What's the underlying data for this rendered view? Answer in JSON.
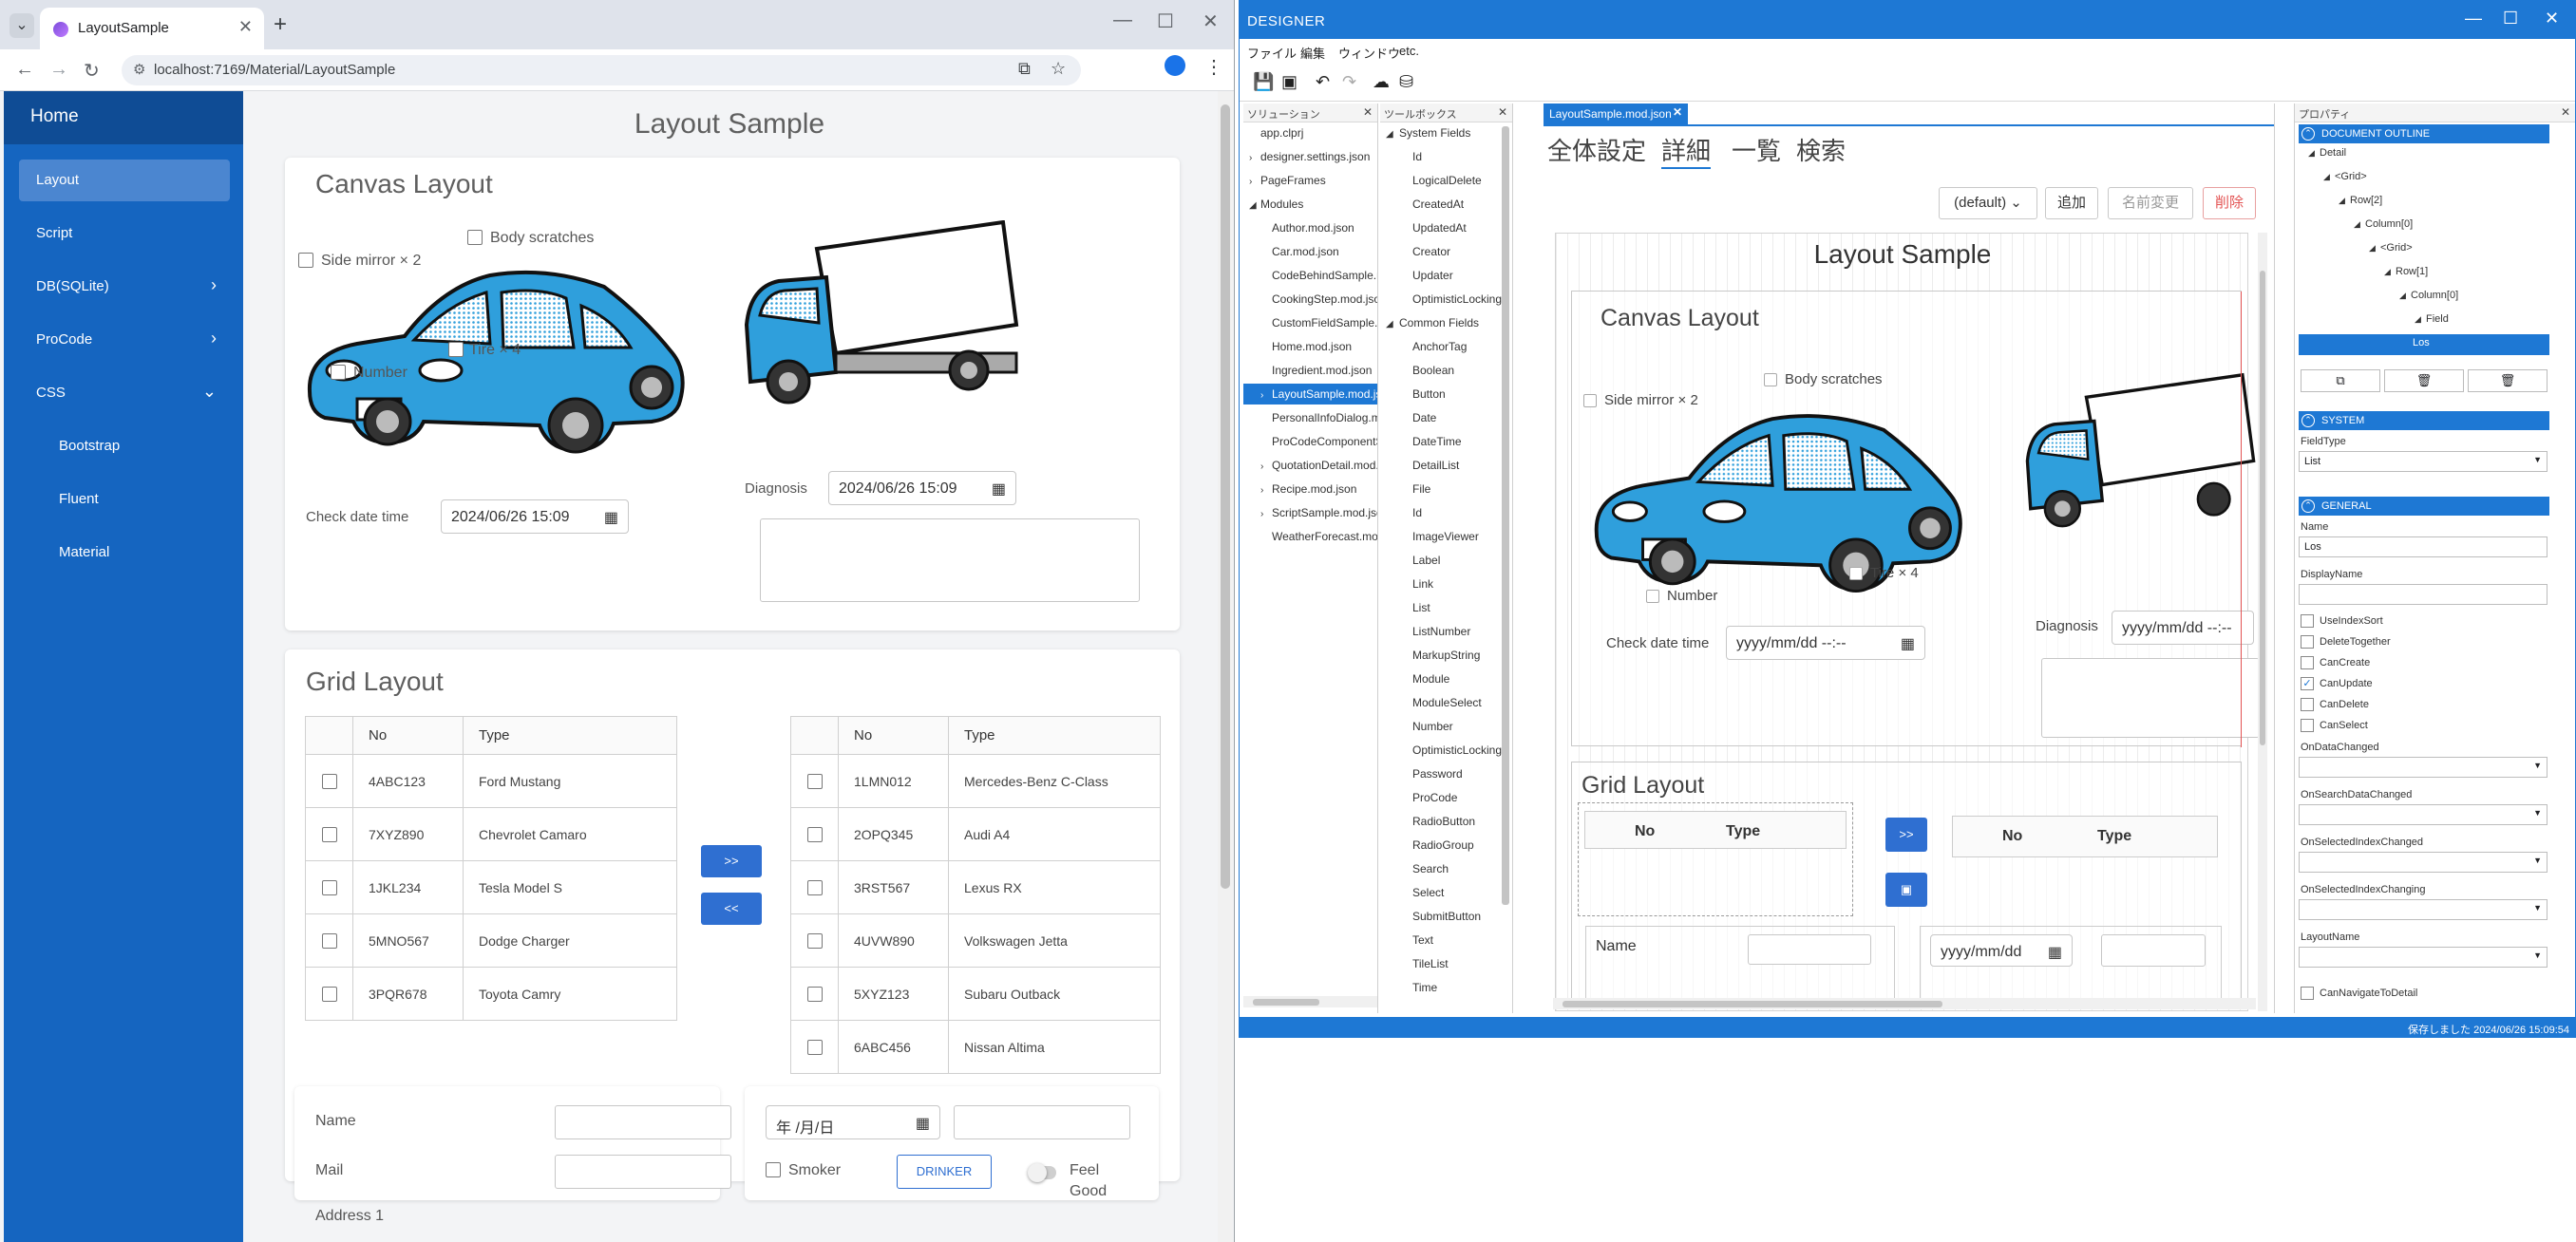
{
  "browser": {
    "tab_title": "LayoutSample",
    "url": "localhost:7169/Material/LayoutSample",
    "new_tab": "+",
    "menu_glyph": "⌄",
    "close_glyph": "✕",
    "minimize_glyph": "—",
    "maximize_glyph": "☐",
    "back_glyph": "←",
    "forward_glyph": "→",
    "reload_glyph": "↻",
    "site_glyph": "⚙",
    "translate_glyph": "⧉",
    "star_glyph": "☆",
    "kebab_glyph": "⋮"
  },
  "sidebar": {
    "home": "Home",
    "items": [
      {
        "label": "Layout",
        "chev": ""
      },
      {
        "label": "Script",
        "chev": ""
      },
      {
        "label": "DB(SQLite)",
        "chev": "›"
      },
      {
        "label": "ProCode",
        "chev": "›"
      },
      {
        "label": "CSS",
        "chev": "⌄"
      },
      {
        "label": "Bootstrap",
        "chev": ""
      },
      {
        "label": "Fluent",
        "chev": ""
      },
      {
        "label": "Material",
        "chev": ""
      }
    ]
  },
  "page": {
    "title": "Layout Sample",
    "canvas": {
      "title": "Canvas Layout",
      "body_scratches": "Body scratches",
      "side_mirror": "Side mirror × 2",
      "tire": "Tire × 4",
      "number": "Number",
      "check_date_label": "Check date time",
      "check_date_value": "2024/06/26 15:09",
      "diagnosis_label": "Diagnosis",
      "diagnosis_value": "2024/06/26 15:09",
      "calendar_glyph": "▦"
    },
    "grid": {
      "title": "Grid Layout",
      "headers": [
        "No",
        "Type"
      ],
      "left_rows": [
        {
          "no": "4ABC123",
          "type": "Ford Mustang"
        },
        {
          "no": "7XYZ890",
          "type": "Chevrolet Camaro"
        },
        {
          "no": "1JKL234",
          "type": "Tesla Model S"
        },
        {
          "no": "5MNO567",
          "type": "Dodge Charger"
        },
        {
          "no": "3PQR678",
          "type": "Toyota Camry"
        }
      ],
      "right_rows": [
        {
          "no": "1LMN012",
          "type": "Mercedes-Benz C-Class"
        },
        {
          "no": "2OPQ345",
          "type": "Audi A4"
        },
        {
          "no": "3RST567",
          "type": "Lexus RX"
        },
        {
          "no": "4UVW890",
          "type": "Volkswagen Jetta"
        },
        {
          "no": "5XYZ123",
          "type": "Subaru Outback"
        },
        {
          "no": "6ABC456",
          "type": "Nissan Altima"
        }
      ],
      "move_right": ">>",
      "move_left": "<<"
    },
    "form": {
      "name": "Name",
      "mail": "Mail",
      "address": "Address 1",
      "date_placeholder": "年 /月/日",
      "smoker": "Smoker",
      "drinker": "DRINKER",
      "feel_good": "Feel Good"
    }
  },
  "designer": {
    "title": "DESIGNER",
    "menus": [
      "ファイル",
      "編集",
      "ウィンドウ",
      "etc."
    ],
    "toolbar_glyphs": [
      "💾",
      "▣",
      "↶",
      "↷",
      "☁",
      "⛁"
    ],
    "solution": {
      "header": "ソリューション",
      "items": [
        {
          "label": "app.clprj",
          "exp": ""
        },
        {
          "label": "designer.settings.json",
          "exp": "›"
        },
        {
          "label": "PageFrames",
          "exp": "›"
        },
        {
          "label": "Modules",
          "exp": "◢"
        },
        {
          "label": "Author.mod.json",
          "exp": ""
        },
        {
          "label": "Car.mod.json",
          "exp": ""
        },
        {
          "label": "CodeBehindSample.m",
          "exp": ""
        },
        {
          "label": "CookingStep.mod.json",
          "exp": ""
        },
        {
          "label": "CustomFieldSample.m",
          "exp": ""
        },
        {
          "label": "Home.mod.json",
          "exp": ""
        },
        {
          "label": "Ingredient.mod.json",
          "exp": ""
        },
        {
          "label": "LayoutSample.mod.jso",
          "exp": "›"
        },
        {
          "label": "PersonalInfoDialog.m",
          "exp": ""
        },
        {
          "label": "ProCodeComponentS",
          "exp": ""
        },
        {
          "label": "QuotationDetail.mod.",
          "exp": "›"
        },
        {
          "label": "Recipe.mod.json",
          "exp": "›"
        },
        {
          "label": "ScriptSample.mod.jso",
          "exp": "›"
        },
        {
          "label": "WeatherForecast.mod",
          "exp": ""
        }
      ]
    },
    "toolbox": {
      "header": "ツールボックス",
      "items": [
        {
          "label": "System Fields",
          "exp": "◢"
        },
        {
          "label": "Id",
          "exp": ""
        },
        {
          "label": "LogicalDelete",
          "exp": ""
        },
        {
          "label": "CreatedAt",
          "exp": ""
        },
        {
          "label": "UpdatedAt",
          "exp": ""
        },
        {
          "label": "Creator",
          "exp": ""
        },
        {
          "label": "Updater",
          "exp": ""
        },
        {
          "label": "OptimisticLocking",
          "exp": ""
        },
        {
          "label": "Common Fields",
          "exp": "◢"
        },
        {
          "label": "AnchorTag",
          "exp": ""
        },
        {
          "label": "Boolean",
          "exp": ""
        },
        {
          "label": "Button",
          "exp": ""
        },
        {
          "label": "Date",
          "exp": ""
        },
        {
          "label": "DateTime",
          "exp": ""
        },
        {
          "label": "DetailList",
          "exp": ""
        },
        {
          "label": "File",
          "exp": ""
        },
        {
          "label": "Id",
          "exp": ""
        },
        {
          "label": "ImageViewer",
          "exp": ""
        },
        {
          "label": "Label",
          "exp": ""
        },
        {
          "label": "Link",
          "exp": ""
        },
        {
          "label": "List",
          "exp": ""
        },
        {
          "label": "ListNumber",
          "exp": ""
        },
        {
          "label": "MarkupString",
          "exp": ""
        },
        {
          "label": "Module",
          "exp": ""
        },
        {
          "label": "ModuleSelect",
          "exp": ""
        },
        {
          "label": "Number",
          "exp": ""
        },
        {
          "label": "OptimisticLocking",
          "exp": ""
        },
        {
          "label": "Password",
          "exp": ""
        },
        {
          "label": "ProCode",
          "exp": ""
        },
        {
          "label": "RadioButton",
          "exp": ""
        },
        {
          "label": "RadioGroup",
          "exp": ""
        },
        {
          "label": "Search",
          "exp": ""
        },
        {
          "label": "Select",
          "exp": ""
        },
        {
          "label": "SubmitButton",
          "exp": ""
        },
        {
          "label": "Text",
          "exp": ""
        },
        {
          "label": "TileList",
          "exp": ""
        },
        {
          "label": "Time",
          "exp": ""
        }
      ]
    },
    "editor": {
      "tab": "LayoutSample.mod.json",
      "jp_tabs": [
        "全体設定",
        "詳細",
        "一覧",
        "検索"
      ],
      "default_select": "(default)",
      "add": "追加",
      "rename": "名前変更",
      "delete": "削除",
      "page_title": "Layout Sample",
      "canvas_title": "Canvas Layout",
      "body_scratches": "Body scratches",
      "side_mirror": "Side mirror × 2",
      "number": "Number",
      "tire": "Tire × 4",
      "check_date_label": "Check date time",
      "check_date_value": "yyyy/mm/dd --:--",
      "diagnosis_label": "Diagnosis",
      "diagnosis_value": "yyyy/mm/dd --:--",
      "grid_title": "Grid Layout",
      "headers": [
        "No",
        "Type"
      ],
      "move_right": ">>",
      "name_label": "Name",
      "date_value": "yyyy/mm/dd"
    },
    "properties": {
      "header": "プロパティ",
      "outline_title": "DOCUMENT OUTLINE",
      "outline": [
        "Detail",
        "<Grid>",
        "Row[2]",
        "Column[0]",
        "<Grid>",
        "Row[1]",
        "Column[0]",
        "Field",
        "Los"
      ],
      "system_title": "SYSTEM",
      "field_type_label": "FieldType",
      "field_type_value": "List",
      "general_title": "GENERAL",
      "name_label": "Name",
      "name_value": "Los",
      "display_name_label": "DisplayName",
      "checks": [
        {
          "label": "UseIndexSort",
          "checked": false
        },
        {
          "label": "DeleteTogether",
          "checked": false
        },
        {
          "label": "CanCreate",
          "checked": false
        },
        {
          "label": "CanUpdate",
          "checked": true
        },
        {
          "label": "CanDelete",
          "checked": false
        },
        {
          "label": "CanSelect",
          "checked": false
        }
      ],
      "events": [
        "OnDataChanged",
        "OnSearchDataChanged",
        "OnSelectedIndexChanged",
        "OnSelectedIndexChanging",
        "LayoutName"
      ],
      "last_check": "CanNavigateToDetail"
    },
    "status": "保存しました 2024/06/26 15:09:54"
  },
  "colors": {
    "sidebar": "#1565c0",
    "designer_accent": "#1e78d4",
    "car_body": "#2f9fdc"
  }
}
